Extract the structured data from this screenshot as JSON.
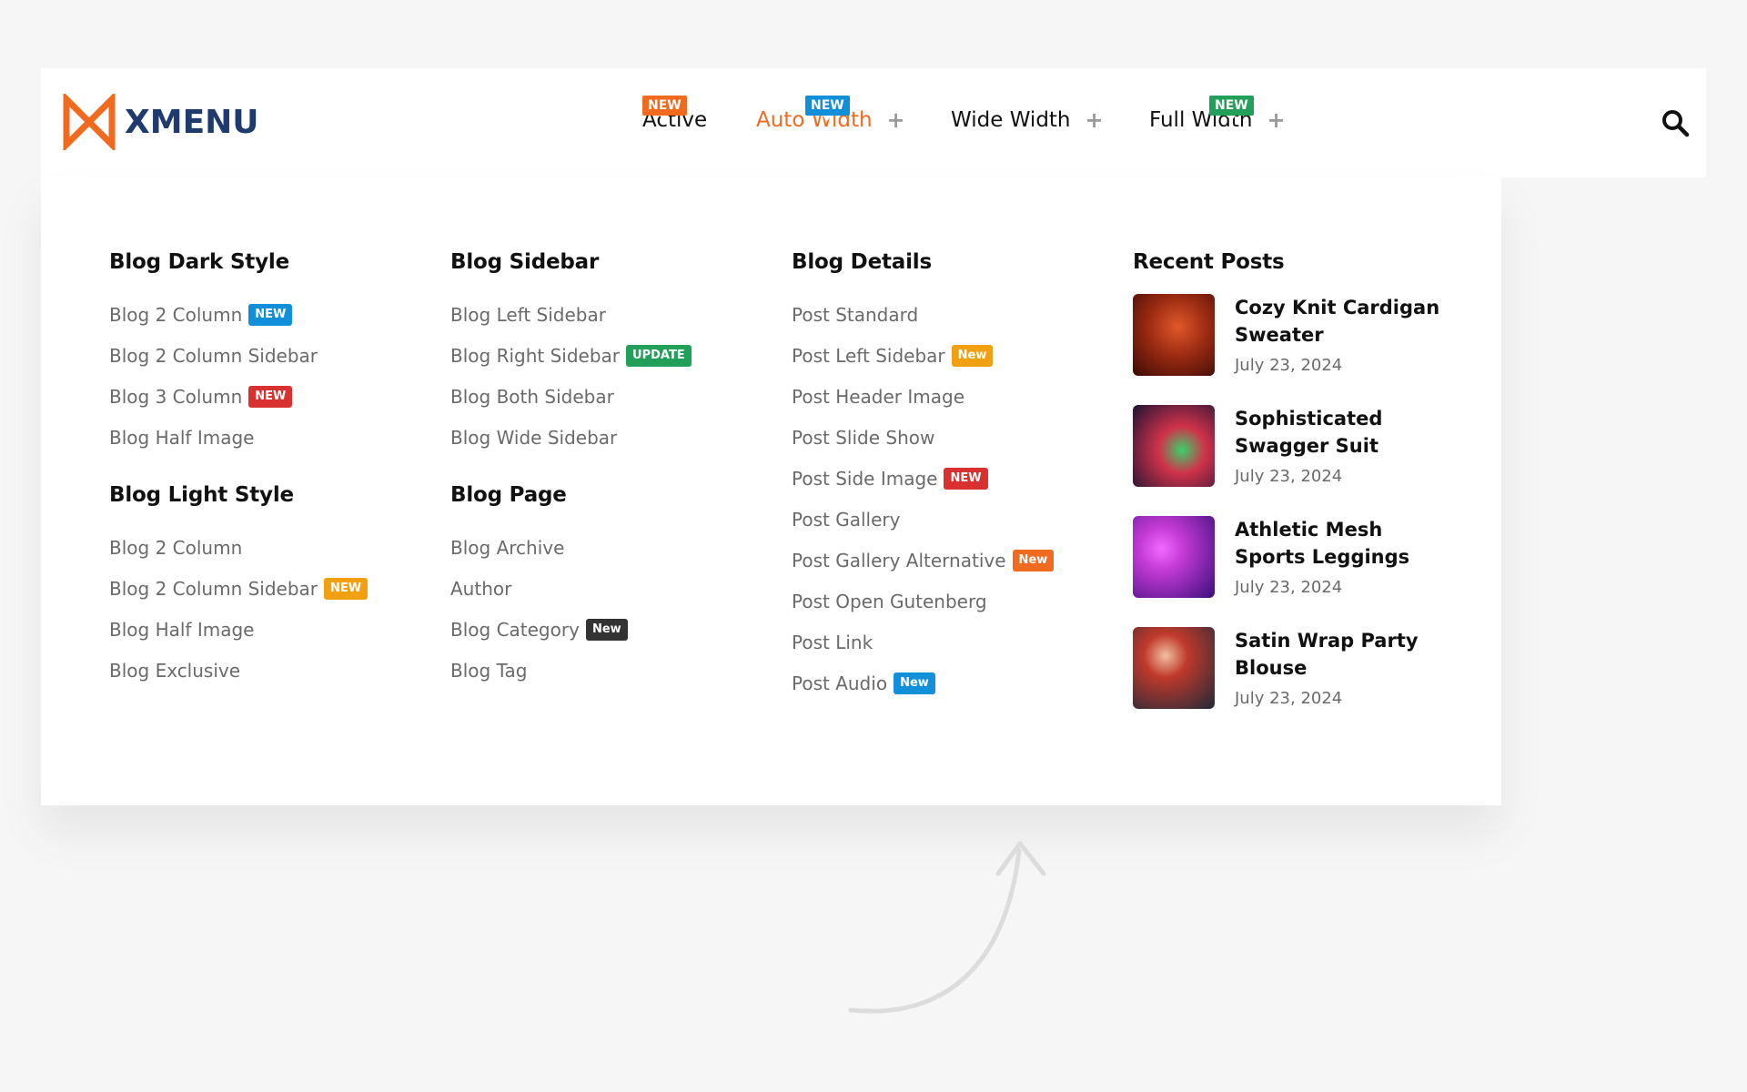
{
  "brand": {
    "name": "XMENU",
    "accent": "#f06a1f",
    "text_color": "#1f3a6d"
  },
  "nav": {
    "items": [
      {
        "label": "Active",
        "badge": "NEW",
        "badge_color": "#f06a1f",
        "has_plus": false
      },
      {
        "label": "Auto Width",
        "badge": "NEW",
        "badge_color": "#1190d9",
        "has_plus": true,
        "active": true
      },
      {
        "label": "Wide Width",
        "badge": "",
        "has_plus": true
      },
      {
        "label": "Full Width",
        "badge": "NEW",
        "badge_color": "#22a05a",
        "has_plus": true
      }
    ],
    "plus_symbol": "+",
    "search_icon": "search-icon"
  },
  "columns": {
    "dark": {
      "heading": "Blog Dark Style",
      "links": [
        {
          "label": "Blog 2 Column",
          "tag": "NEW",
          "tag_color": "#1190d9"
        },
        {
          "label": "Blog 2 Column Sidebar",
          "tag": ""
        },
        {
          "label": "Blog 3 Column",
          "tag": "NEW",
          "tag_color": "#d93030"
        },
        {
          "label": "Blog Half Image",
          "tag": ""
        }
      ]
    },
    "light": {
      "heading": "Blog Light Style",
      "links": [
        {
          "label": "Blog 2 Column",
          "tag": ""
        },
        {
          "label": "Blog 2 Column Sidebar",
          "tag": "NEW",
          "tag_color": "#f0a010"
        },
        {
          "label": "Blog Half Image",
          "tag": ""
        },
        {
          "label": "Blog Exclusive",
          "tag": ""
        }
      ]
    },
    "sidebar": {
      "heading": "Blog Sidebar",
      "links": [
        {
          "label": "Blog Left Sidebar",
          "tag": ""
        },
        {
          "label": "Blog Right Sidebar",
          "tag": "UPDATE",
          "tag_color": "#22a05a"
        },
        {
          "label": "Blog Both Sidebar",
          "tag": ""
        },
        {
          "label": "Blog Wide Sidebar",
          "tag": ""
        }
      ]
    },
    "page": {
      "heading": "Blog Page",
      "links": [
        {
          "label": "Blog Archive",
          "tag": ""
        },
        {
          "label": "Author",
          "tag": ""
        },
        {
          "label": "Blog Category",
          "tag": "New",
          "tag_color": "#333333"
        },
        {
          "label": "Blog Tag",
          "tag": ""
        }
      ]
    },
    "details": {
      "heading": "Blog Details",
      "links": [
        {
          "label": "Post Standard",
          "tag": ""
        },
        {
          "label": "Post Left Sidebar",
          "tag": "New",
          "tag_color": "#f0a010"
        },
        {
          "label": "Post Header Image",
          "tag": ""
        },
        {
          "label": "Post Slide Show",
          "tag": ""
        },
        {
          "label": "Post Side Image",
          "tag": "NEW",
          "tag_color": "#d93030"
        },
        {
          "label": "Post Gallery",
          "tag": ""
        },
        {
          "label": "Post Gallery Alternative",
          "tag": "New",
          "tag_color": "#f06a1f"
        },
        {
          "label": "Post Open Gutenberg",
          "tag": ""
        },
        {
          "label": "Post Link",
          "tag": ""
        },
        {
          "label": "Post Audio",
          "tag": "New",
          "tag_color": "#1190d9"
        }
      ]
    },
    "recent": {
      "heading": "Recent Posts",
      "posts": [
        {
          "title": "Cozy Knit Cardigan Sweater",
          "date": "July 23, 2024",
          "thumb_a": "#6b1a0e",
          "thumb_b": "#e0582a"
        },
        {
          "title": "Sophisticated Swagger Suit",
          "date": "July 23, 2024",
          "thumb_a": "#1a1233",
          "thumb_b": "#d0324a"
        },
        {
          "title": "Athletic Mesh Sports Leggings",
          "date": "July 23, 2024",
          "thumb_a": "#3a0f7a",
          "thumb_b": "#c43ad6"
        },
        {
          "title": "Satin Wrap Party Blouse",
          "date": "July 23, 2024",
          "thumb_a": "#1d2a3a",
          "thumb_b": "#c0392b"
        }
      ]
    }
  }
}
